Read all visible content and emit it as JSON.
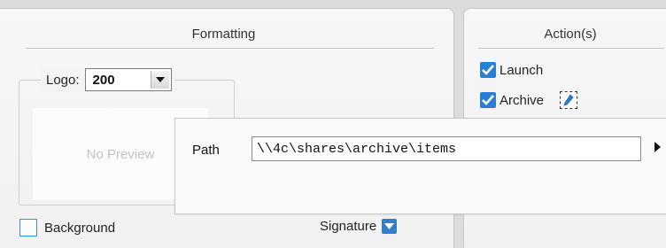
{
  "formatting": {
    "title": "Formatting",
    "logo": {
      "label": "Logo:",
      "selected": "200",
      "preview_text": "No Preview"
    },
    "background": {
      "label": "Background",
      "checked": false
    },
    "signature": {
      "label": "Signature",
      "icon": "chevron-down-icon"
    }
  },
  "actions": {
    "title": "Action(s)",
    "launch": {
      "label": "Launch",
      "checked": true
    },
    "archive": {
      "label": "Archive",
      "checked": true,
      "edit_icon": "pencil-icon"
    }
  },
  "path_popup": {
    "label": "Path",
    "value": "\\\\4c\\shares\\archive\\items",
    "expand_icon": "triangle-right-icon"
  },
  "colors": {
    "accent": "#2a7fd4",
    "panel_bg": "#f4f4f4",
    "window_bg": "#dcdcdc"
  }
}
